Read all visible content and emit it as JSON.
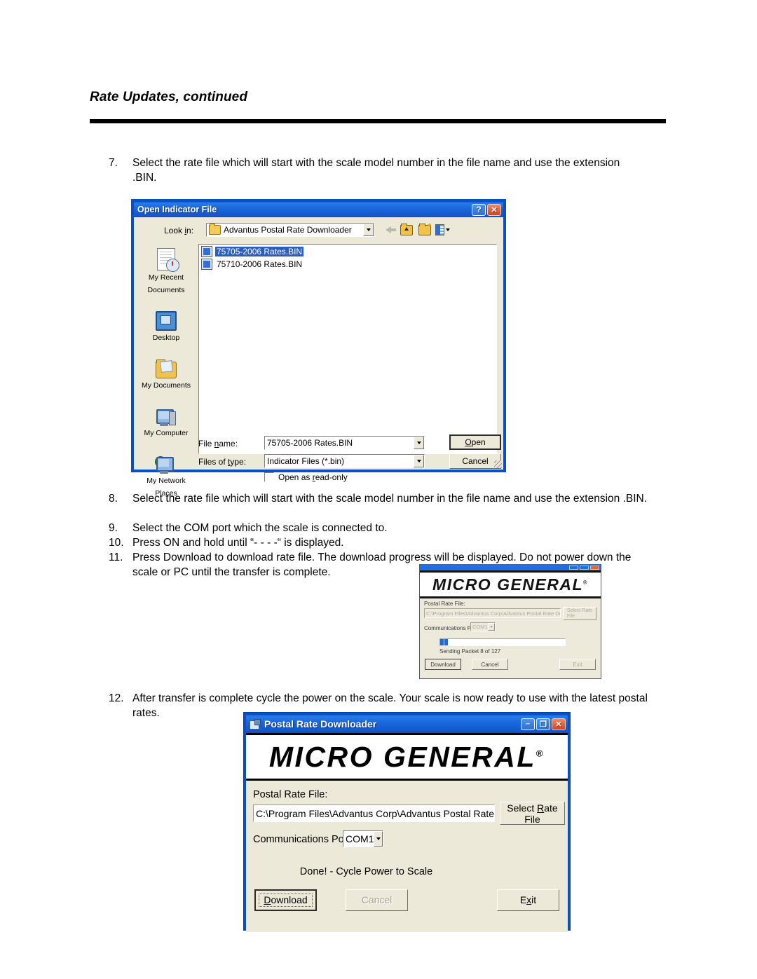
{
  "document": {
    "heading": "Rate Updates, continued",
    "steps": [
      {
        "num": "7.",
        "text": "Select the rate file which will start with the scale model number in the file name and use the extension .BIN."
      },
      {
        "num": "8.",
        "text": "Select the rate file which will start with the scale model number in the file name and use the extension .BIN."
      },
      {
        "num": "9.",
        "text": "Select the COM port which the scale is connected to."
      },
      {
        "num": "10.",
        "text": "Press ON and hold until “- - - -“ is displayed."
      },
      {
        "num": "11.",
        "text": "Press Download  to download rate file. The download progress will be displayed. Do not power down the scale or PC until the transfer is complete."
      },
      {
        "num": "12.",
        "text": "After transfer is complete cycle the power on the scale. Your scale is now ready to use with the latest postal rates."
      }
    ]
  },
  "open_dialog": {
    "title": "Open Indicator File",
    "help_button": "?",
    "close_button": "✕",
    "lookin_label": "Look in:",
    "lookin_value": "Advantus Postal Rate Downloader",
    "toolbar": {
      "back": "back-arrow",
      "up": "up-one-level",
      "new_folder": "new-folder",
      "views": "views"
    },
    "places": [
      {
        "label": "My Recent\nDocuments",
        "icon": "recent-documents-icon"
      },
      {
        "label": "Desktop",
        "icon": "desktop-icon"
      },
      {
        "label": "My Documents",
        "icon": "my-documents-icon"
      },
      {
        "label": "My Computer",
        "icon": "my-computer-icon"
      },
      {
        "label": "My Network\nPlaces",
        "icon": "my-network-places-icon"
      }
    ],
    "files": [
      {
        "name": "75705-2006 Rates.BIN",
        "selected": true
      },
      {
        "name": "75710-2006 Rates.BIN",
        "selected": false
      }
    ],
    "filename_label": "File name:",
    "filename_value": "75705-2006 Rates.BIN",
    "filetype_label": "Files of type:",
    "filetype_value": "Indicator Files (*.bin)",
    "readonly_label": "Open as read-only",
    "readonly_checked": false,
    "open_button": "Open",
    "cancel_button": "Cancel"
  },
  "mini_window": {
    "logo": "MICRO GENERAL",
    "logo_mark": "®",
    "rate_file_label": "Postal Rate File:",
    "rate_file_value": "C:\\Program Files\\Advantus Corp\\Advantus Postal Rate Downl",
    "select_button": "Select Rate\nFile",
    "port_label": "Communications Port:",
    "port_value": "COM1",
    "progress_status": "Sending Packet 8 of 127",
    "progress_percent": 6,
    "download_button": "Download",
    "cancel_button": "Cancel",
    "exit_button": "Exit"
  },
  "main_window": {
    "title": "Postal Rate Downloader",
    "minimize_button": "–",
    "maximize_button": "❐",
    "close_button": "✕",
    "logo": "MICRO GENERAL",
    "logo_mark": "®",
    "rate_file_label": "Postal Rate File:",
    "rate_file_value": "C:\\Program Files\\Advantus Corp\\Advantus Postal Rate Downl",
    "select_button_line1": "Select Rate",
    "select_button_line2": "File",
    "port_label": "Communications Port:",
    "port_value": "COM1",
    "status": "Done! - Cycle Power to Scale",
    "download_button": "Download",
    "cancel_button": "Cancel",
    "exit_button": "Exit"
  },
  "colors": {
    "xp_title_blue": "#1158cf",
    "window_face": "#ece9d8",
    "selection_blue": "#2a5fc0",
    "progress_blue": "#1658c8",
    "close_red": "#d4431a"
  }
}
